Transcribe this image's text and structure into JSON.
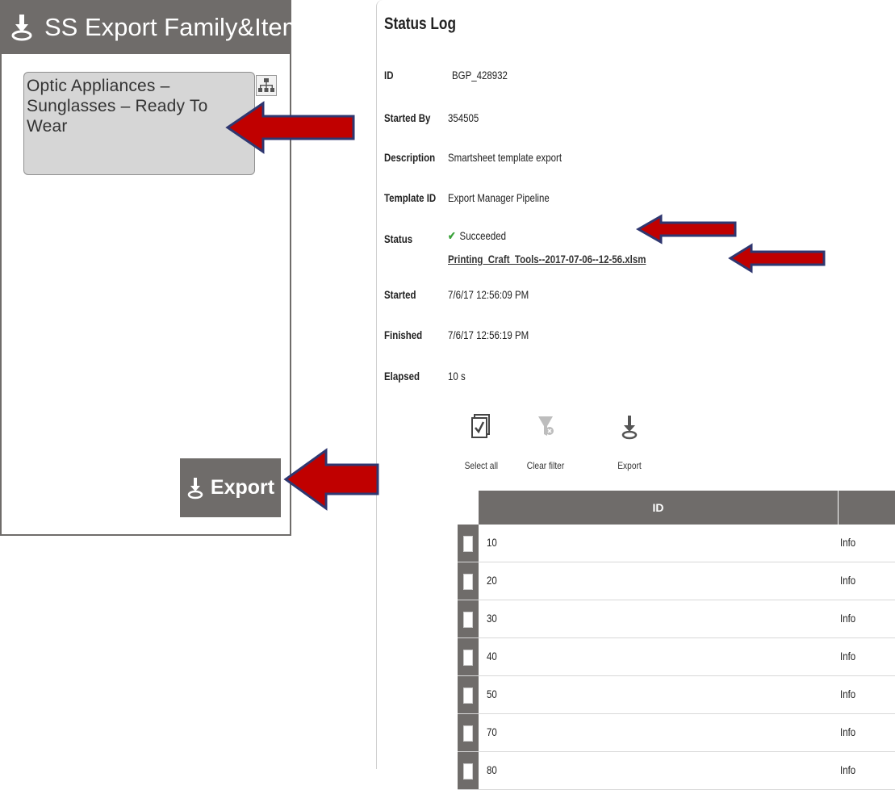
{
  "left_panel": {
    "title": "SS Export Family&Items",
    "tile_title": "Optic Appliances – Sunglasses – Ready To Wear",
    "export_label": "Export"
  },
  "status_log": {
    "title": "Status Log",
    "fields": {
      "id": {
        "label": "ID",
        "value": "BGP_428932"
      },
      "started_by": {
        "label": "Started By",
        "value": "354505"
      },
      "description": {
        "label": "Description",
        "value": "Smartsheet template export"
      },
      "template_id": {
        "label": "Template ID",
        "value": "Export Manager Pipeline"
      },
      "status": {
        "label": "Status",
        "value": "Succeeded",
        "file_link": "Printing_Craft_Tools--2017-07-06--12-56.xlsm"
      },
      "started": {
        "label": "Started",
        "value": "7/6/17 12:56:09 PM"
      },
      "finished": {
        "label": "Finished",
        "value": "7/6/17 12:56:19 PM"
      },
      "elapsed": {
        "label": "Elapsed",
        "value": "10 s"
      }
    },
    "toolbar": {
      "select_all": "Select all",
      "clear_filter": "Clear filter",
      "export": "Export"
    },
    "table": {
      "header_id": "ID",
      "rows": [
        {
          "id": "10",
          "level": "Info"
        },
        {
          "id": "20",
          "level": "Info"
        },
        {
          "id": "30",
          "level": "Info"
        },
        {
          "id": "40",
          "level": "Info"
        },
        {
          "id": "50",
          "level": "Info"
        },
        {
          "id": "70",
          "level": "Info"
        },
        {
          "id": "80",
          "level": "Info"
        }
      ]
    }
  },
  "colors": {
    "header_gray": "#6f6c6a",
    "tile_gray": "#d6d6d6",
    "arrow_red": "#c00000",
    "arrow_outline": "#2f3770",
    "success_green": "#3aa23a"
  },
  "icons": [
    "download-icon",
    "hierarchy-icon",
    "checkmark-icon",
    "select-all-icon",
    "clear-filter-icon",
    "export-icon"
  ]
}
